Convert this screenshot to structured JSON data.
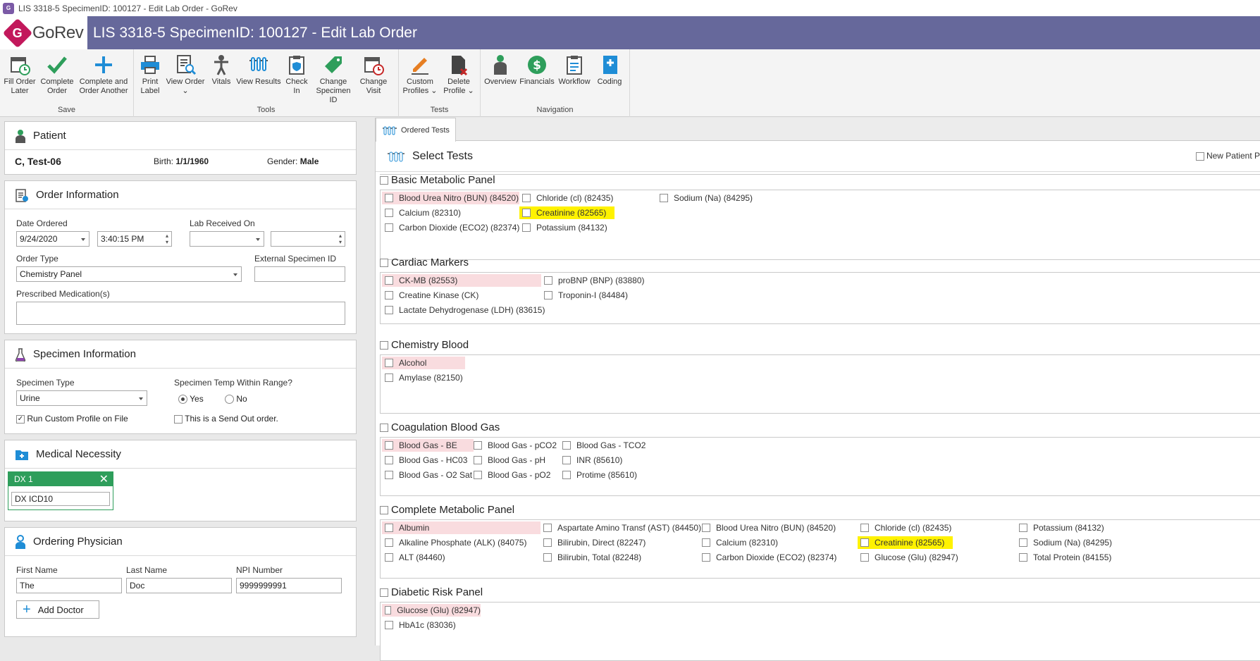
{
  "window_title": "LIS 3318-5 SpecimenID: 100127 - Edit Lab Order - GoRev",
  "app": {
    "logo_text": "GoRev",
    "header_title": "LIS 3318-5 SpecimenID: 100127 - Edit Lab Order"
  },
  "ribbon": {
    "groups": {
      "save": "Save",
      "tools": "Tools",
      "tests": "Tests",
      "navigation": "Navigation"
    },
    "buttons": {
      "fill_later": [
        "Fill Order",
        "Later"
      ],
      "complete": [
        "Complete",
        "Order"
      ],
      "complete_another": [
        "Complete and",
        "Order Another"
      ],
      "print_label": [
        "Print",
        "Label"
      ],
      "view_order": [
        "View Order",
        "⌄"
      ],
      "vitals": [
        "Vitals",
        ""
      ],
      "view_results": [
        "View Results",
        ""
      ],
      "check_in": [
        "Check",
        "In"
      ],
      "change_specimen": [
        "Change",
        "Specimen ID"
      ],
      "change_visit": [
        "Change",
        "Visit"
      ],
      "custom_profiles": [
        "Custom",
        "Profiles ⌄"
      ],
      "delete_profile": [
        "Delete",
        "Profile ⌄"
      ],
      "overview": [
        "Overview",
        ""
      ],
      "financials": [
        "Financials",
        ""
      ],
      "workflow": [
        "Workflow",
        ""
      ],
      "coding": [
        "Coding",
        ""
      ]
    }
  },
  "patient": {
    "header": "Patient",
    "name": "C, Test-06",
    "birth_label": "Birth:",
    "birth": "1/1/1960",
    "gender_label": "Gender:",
    "gender": "Male"
  },
  "order": {
    "header": "Order Information",
    "date_ordered_label": "Date Ordered",
    "date_ordered": "9/24/2020",
    "time_ordered": "3:40:15 PM",
    "lab_received_label": "Lab Received On",
    "lab_received_date": "",
    "lab_received_time": "",
    "order_type_label": "Order Type",
    "order_type": "Chemistry Panel",
    "external_id_label": "External Specimen ID",
    "external_id": "",
    "meds_label": "Prescribed Medication(s)",
    "meds": ""
  },
  "specimen": {
    "header": "Specimen Information",
    "type_label": "Specimen Type",
    "type": "Urine",
    "temp_label": "Specimen Temp Within Range?",
    "yes": "Yes",
    "no": "No",
    "temp_value": "Yes",
    "run_custom": "Run Custom Profile on File",
    "run_custom_checked": true,
    "send_out": "This is a Send Out order.",
    "send_out_checked": false
  },
  "medical": {
    "header": "Medical Necessity",
    "dx_title": "DX 1",
    "dx_value": "DX ICD10"
  },
  "physician": {
    "header": "Ordering Physician",
    "first_label": "First Name",
    "first": "The",
    "last_label": "Last Name",
    "last": "Doc",
    "npi_label": "NPI Number",
    "npi": "9999999991",
    "add_doctor": "Add Doctor"
  },
  "tests_panel": {
    "tab": "Ordered Tests",
    "header": "Select Tests",
    "new_patient": "New Patient P",
    "sections": [
      {
        "title": "Basic Metabolic Panel",
        "tests": [
          {
            "label": "Blood Urea Nitro (BUN) (84520)",
            "style": "pink"
          },
          {
            "label": "Calcium (82310)",
            "style": ""
          },
          {
            "label": "Carbon Dioxide (ECO2) (82374)",
            "style": ""
          },
          {
            "label": "Chloride (cl) (82435)",
            "style": ""
          },
          {
            "label": "Creatinine (82565)",
            "style": "yellow"
          },
          {
            "label": "Potassium (84132)",
            "style": ""
          },
          {
            "label": "Sodium (Na) (84295)",
            "style": ""
          }
        ]
      },
      {
        "title": "Cardiac Markers",
        "tests": [
          {
            "label": "CK-MB (82553)",
            "style": "pink"
          },
          {
            "label": "Creatine Kinase (CK)",
            "style": ""
          },
          {
            "label": "Lactate Dehydrogenase (LDH) (83615)",
            "style": ""
          },
          {
            "label": "proBNP (BNP) (83880)",
            "style": ""
          },
          {
            "label": "Troponin-I (84484)",
            "style": ""
          }
        ]
      },
      {
        "title": "Chemistry Blood",
        "tests": [
          {
            "label": "Alcohol",
            "style": "pink"
          },
          {
            "label": "Amylase (82150)",
            "style": ""
          }
        ]
      },
      {
        "title": "Coagulation  Blood Gas",
        "tests": [
          {
            "label": "Blood Gas - BE",
            "style": "pink"
          },
          {
            "label": "Blood Gas - HC03",
            "style": ""
          },
          {
            "label": "Blood Gas - O2 Sat",
            "style": ""
          },
          {
            "label": "Blood Gas - pCO2",
            "style": ""
          },
          {
            "label": "Blood Gas - pH",
            "style": ""
          },
          {
            "label": "Blood Gas - pO2",
            "style": ""
          },
          {
            "label": "Blood Gas - TCO2",
            "style": ""
          },
          {
            "label": "INR (85610)",
            "style": ""
          },
          {
            "label": "Protime (85610)",
            "style": ""
          }
        ]
      },
      {
        "title": "Complete Metabolic Panel",
        "tests": [
          {
            "label": "Albumin",
            "style": "pink"
          },
          {
            "label": "Alkaline Phosphate (ALK) (84075)",
            "style": ""
          },
          {
            "label": "ALT (84460)",
            "style": ""
          },
          {
            "label": "Aspartate Amino Transf (AST) (84450)",
            "style": ""
          },
          {
            "label": "Bilirubin, Direct (82247)",
            "style": ""
          },
          {
            "label": "Bilirubin, Total (82248)",
            "style": ""
          },
          {
            "label": "Blood Urea Nitro (BUN) (84520)",
            "style": ""
          },
          {
            "label": "Calcium (82310)",
            "style": ""
          },
          {
            "label": "Carbon Dioxide (ECO2) (82374)",
            "style": ""
          },
          {
            "label": "Chloride (cl) (82435)",
            "style": ""
          },
          {
            "label": "Creatinine (82565)",
            "style": "yellow"
          },
          {
            "label": "Glucose (Glu) (82947)",
            "style": ""
          },
          {
            "label": "Potassium (84132)",
            "style": ""
          },
          {
            "label": "Sodium (Na) (84295)",
            "style": ""
          },
          {
            "label": "Total Protein (84155)",
            "style": ""
          }
        ]
      },
      {
        "title": "Diabetic Risk Panel",
        "tests": [
          {
            "label": "Glucose (Glu) (82947)",
            "style": "pink"
          },
          {
            "label": "HbA1c (83036)",
            "style": ""
          }
        ]
      }
    ]
  },
  "colors": {
    "header_bg": "#66689b",
    "pink_highlight": "#f9dcdf",
    "yellow_highlight": "#fff200",
    "dx_green": "#2e9e5b",
    "accent_blue": "#1f8dd6"
  }
}
